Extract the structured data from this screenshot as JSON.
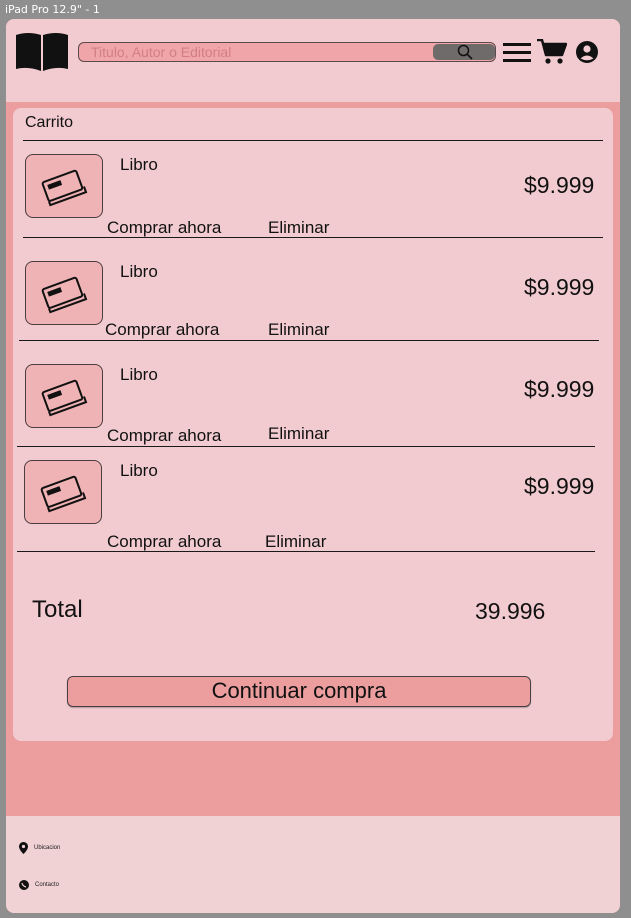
{
  "frame": {
    "label": "iPad Pro 12.9\" - 1"
  },
  "header": {
    "logo_icon": "open-book-icon",
    "search": {
      "placeholder": "Titulo, Autor o Editorial",
      "button_icon": "search-icon"
    },
    "menu_icon": "hamburger-icon",
    "cart_icon": "shopping-cart-icon",
    "user_icon": "user-icon"
  },
  "cart": {
    "title": "Carrito",
    "items": [
      {
        "name": "Libro",
        "price": "$9.999",
        "buy_label": "Comprar ahora",
        "remove_label": "Eliminar"
      },
      {
        "name": "Libro",
        "price": "$9.999",
        "buy_label": "Comprar ahora",
        "remove_label": "Eliminar"
      },
      {
        "name": "Libro",
        "price": "$9.999",
        "buy_label": "Comprar ahora",
        "remove_label": "Eliminar"
      },
      {
        "name": "Libro",
        "price": "$9.999",
        "buy_label": "Comprar ahora",
        "remove_label": "Eliminar"
      }
    ],
    "total_label": "Total",
    "total_value": "39.996",
    "continue_label": "Continuar compra"
  },
  "footer": {
    "location_label": "Ubicacion",
    "contact_label": "Contacto"
  },
  "colors": {
    "background": "#8f8f8f",
    "page": "#ec9e9f",
    "panel": "#f1cbd0",
    "accent": "#f0a6a8",
    "footer": "#f0d1d4"
  }
}
